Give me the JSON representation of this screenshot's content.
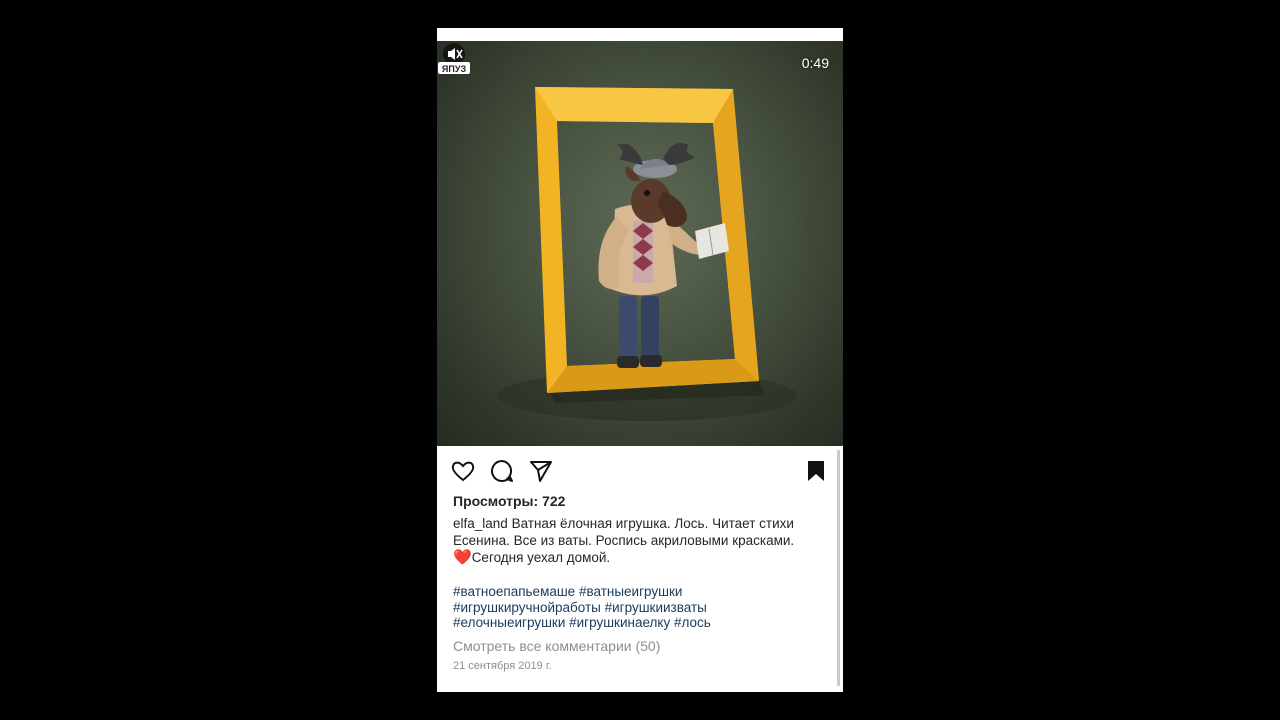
{
  "post": {
    "duration": "0:49",
    "views_label": "Просмотры: 722",
    "username": "elfa_land",
    "caption_line1": "Ватная ёлочная игрушка. Лось. Читает стихи Есенина. Все из ваты. Роспись акриловыми красками.",
    "heart": "❤️",
    "caption_line2": "Сегодня уехал домой.",
    "hashtags": [
      "#ватноепапьемаше",
      "#ватныеигрушки",
      "#игрушкиручнойработы",
      "#игрушкиизваты",
      "#елочныеигрушки",
      "#игрушкинаелку",
      "#лось"
    ],
    "view_comments": "Смотреть все комментарии (50)",
    "date": "21 сентября 2019 г.",
    "watermark": "ЯПУЗ"
  },
  "icons": {
    "like": "heart-outline-icon",
    "comment": "speech-bubble-icon",
    "share": "paper-plane-icon",
    "save": "bookmark-filled-icon",
    "mute": "speaker-muted-icon"
  },
  "colors": {
    "frame": "#f2b325",
    "background": "#47513f",
    "text": "#262626",
    "hashtag": "#1b3a5c",
    "muted": "#8e8e8e"
  }
}
